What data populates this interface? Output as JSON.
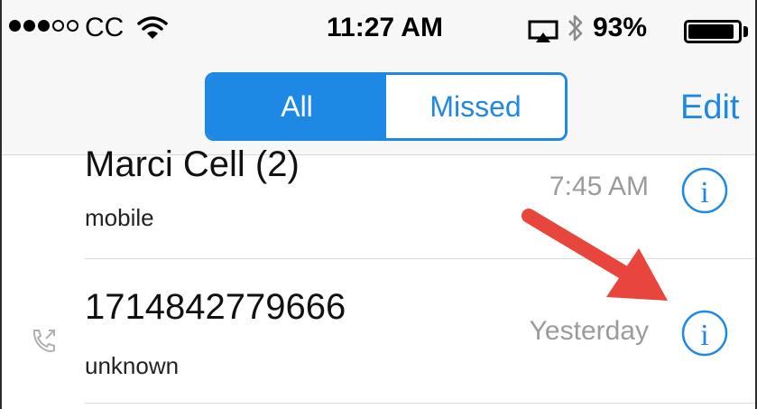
{
  "status_bar": {
    "carrier": "CC",
    "time": "11:27 AM",
    "battery_percent": "93%",
    "battery_level": 0.93,
    "signal_bars_filled": 3,
    "signal_bars_total": 5
  },
  "nav": {
    "segments": [
      {
        "label": "All",
        "selected": true
      },
      {
        "label": "Missed",
        "selected": false
      }
    ],
    "edit_label": "Edit"
  },
  "calls": [
    {
      "name": "Marci Cell (2)",
      "type": "mobile",
      "time": "7:45 AM",
      "direction_icon": "none"
    },
    {
      "name": "1714842779666",
      "type": "unknown",
      "time": "Yesterday",
      "direction_icon": "outgoing-call-icon"
    }
  ],
  "colors": {
    "accent": "#1e88e5",
    "secondary_text": "#9b9b9b",
    "annotation_arrow": "#e8453c"
  },
  "icons": {
    "info": "info-icon",
    "wifi": "wifi-icon",
    "airplay": "airplay-icon",
    "bluetooth": "bluetooth-icon",
    "battery": "battery-icon"
  }
}
